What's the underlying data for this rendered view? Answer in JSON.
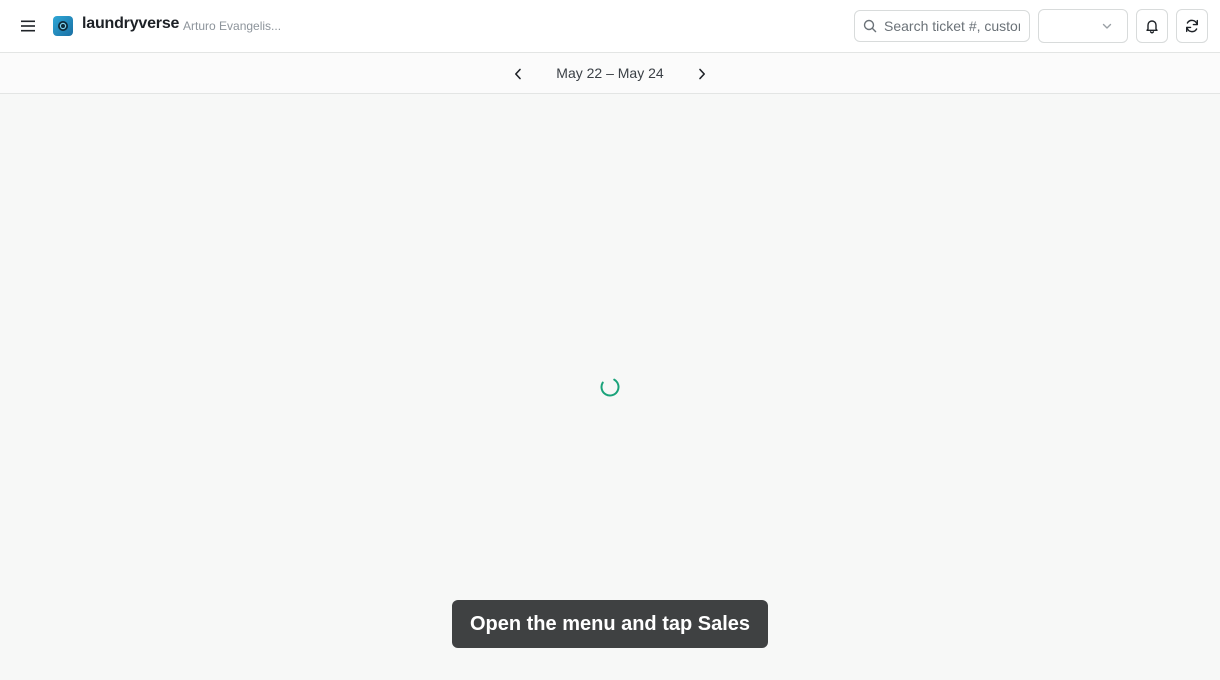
{
  "header": {
    "brand": "laundryverse",
    "user": "Arturo Evangelis...",
    "menu_icon": "menu-icon",
    "search": {
      "placeholder": "Search ticket #, customer",
      "value": ""
    },
    "location_select": {
      "value": ""
    },
    "notifications_icon": "bell-icon",
    "refresh_icon": "refresh-icon"
  },
  "date_nav": {
    "range": "May 22 – May 24",
    "prev_icon": "chevron-left-icon",
    "next_icon": "chevron-right-icon"
  },
  "main": {
    "loading": true,
    "spinner_color": "#1aa37a"
  },
  "toast": {
    "message": "Open the menu and tap Sales"
  }
}
